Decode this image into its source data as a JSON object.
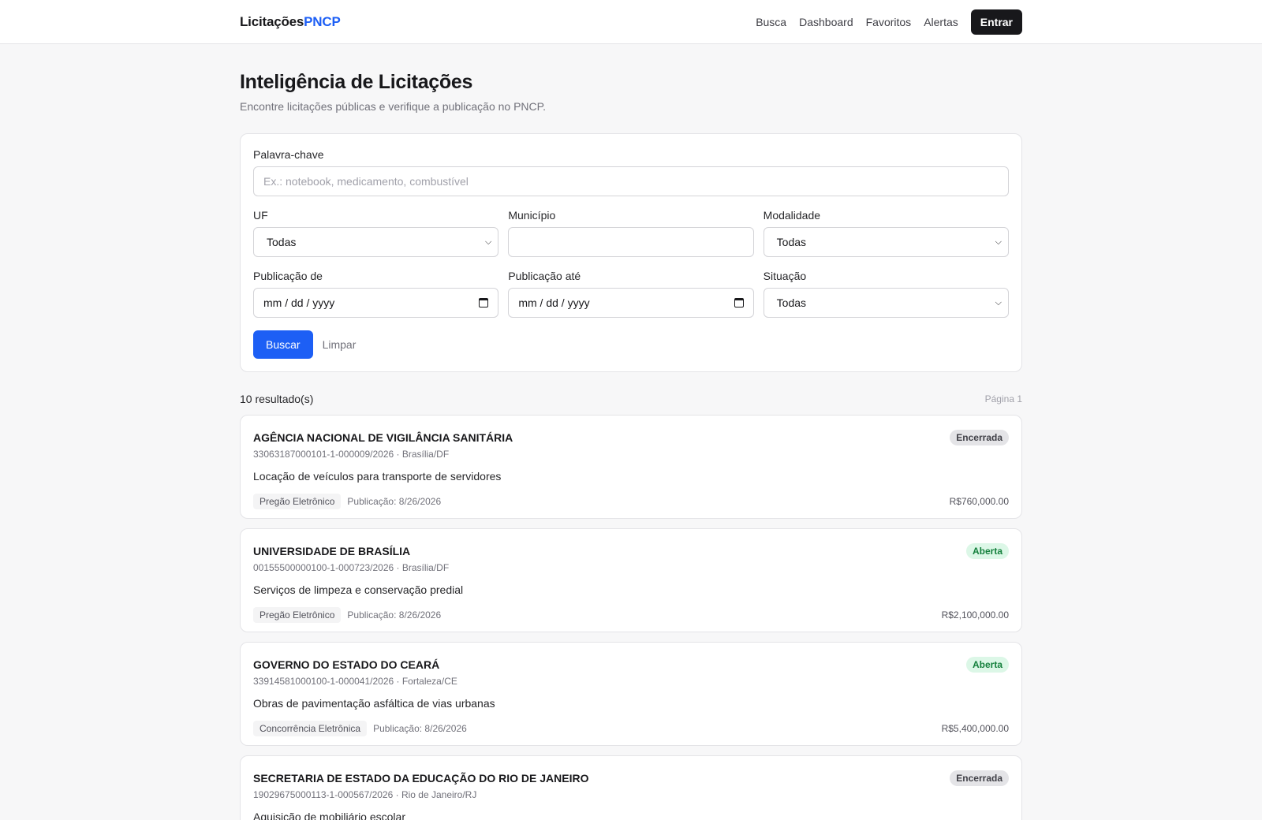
{
  "header": {
    "logo_main": "Licitações",
    "logo_accent": "PNCP",
    "nav": [
      "Busca",
      "Dashboard",
      "Favoritos",
      "Alertas"
    ],
    "login_label": "Entrar"
  },
  "page": {
    "title": "Inteligência de Licitações",
    "subtitle": "Encontre licitações públicas e verifique a publicação no PNCP."
  },
  "form": {
    "keyword_label": "Palavra-chave",
    "keyword_placeholder": "Ex.: notebook, medicamento, combustível",
    "uf_label": "UF",
    "uf_value": "Todas",
    "municipio_label": "Município",
    "municipio_value": "",
    "modalidade_label": "Modalidade",
    "modalidade_value": "Todas",
    "pub_de_label": "Publicação de",
    "pub_de_value": "mm / dd / yyyy",
    "pub_ate_label": "Publicação até",
    "pub_ate_value": "mm / dd / yyyy",
    "situacao_label": "Situação",
    "situacao_value": "Todas",
    "search_label": "Buscar",
    "clear_label": "Limpar"
  },
  "results": {
    "count": "10 resultado(s)",
    "page": "Página 1",
    "items": [
      {
        "org": "AGÊNCIA NACIONAL DE VIGILÂNCIA SANITÁRIA",
        "meta": "33063187000101-1-000009/2026 · Brasília/DF",
        "status": "Encerrada",
        "desc": "Locação de veículos para transporte de servidores",
        "modalidade": "Pregão Eletrônico",
        "publicacao": "Publicação: 8/26/2026",
        "valor": "R$760,000.00"
      },
      {
        "org": "UNIVERSIDADE DE BRASÍLIA",
        "meta": "00155500000100-1-000723/2026 · Brasília/DF",
        "status": "Aberta",
        "desc": "Serviços de limpeza e conservação predial",
        "modalidade": "Pregão Eletrônico",
        "publicacao": "Publicação: 8/26/2026",
        "valor": "R$2,100,000.00"
      },
      {
        "org": "GOVERNO DO ESTADO DO CEARÁ",
        "meta": "33914581000100-1-000041/2026 · Fortaleza/CE",
        "status": "Aberta",
        "desc": "Obras de pavimentação asfáltica de vias urbanas",
        "modalidade": "Concorrência Eletrônica",
        "publicacao": "Publicação: 8/26/2026",
        "valor": "R$5,400,000.00"
      },
      {
        "org": "SECRETARIA DE ESTADO DA EDUCAÇÃO DO RIO DE JANEIRO",
        "meta": "19029675000113-1-000567/2026 · Rio de Janeiro/RJ",
        "status": "Encerrada",
        "desc": "Aquisição de mobiliário escolar",
        "modalidade": "",
        "publicacao": "",
        "valor": ""
      }
    ]
  }
}
